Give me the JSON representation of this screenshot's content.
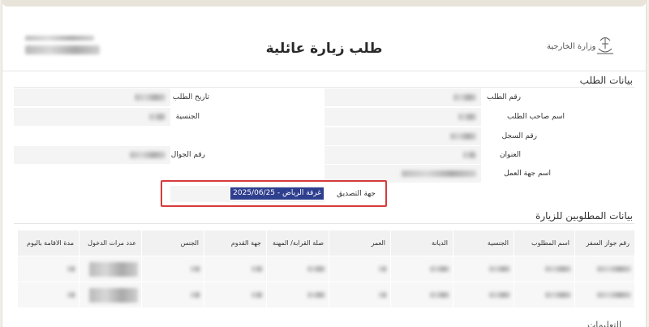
{
  "page": {
    "title": "طلب زيارة عائلية"
  },
  "header": {
    "logo_text": "وزارة الخارجية"
  },
  "request_section": {
    "heading": "بيانات الطلب",
    "labels": {
      "request_number": "رقم الطلب",
      "request_date": "تاريخ الطلب",
      "applicant_name": "اسم صاحب الطلب",
      "nationality": "الجنسية",
      "record_number": "رقم السجل",
      "address": "العنوان",
      "mobile_number": "رقم الجوال",
      "employer_name": "اسم جهة العمل",
      "attestation_authority": "جهة التصديق"
    },
    "attestation_value": "غرفة الرياض - 2025/06/25"
  },
  "visitors_section": {
    "heading": "بيانات المطلوبين للزيارة",
    "columns": [
      "رقم جواز السفر",
      "اسم المطلوب",
      "الجنسية",
      "الديانة",
      "العمر",
      "صلة القرابة/ المهنة",
      "جهة القدوم",
      "الجنس",
      "عدد مرات الدخول",
      "مدة الاقامة باليوم"
    ]
  },
  "footer_section": {
    "heading": "التعليمات"
  },
  "colors": {
    "highlight_border": "#d63b3b",
    "selection_bg": "#2f3f8f"
  }
}
